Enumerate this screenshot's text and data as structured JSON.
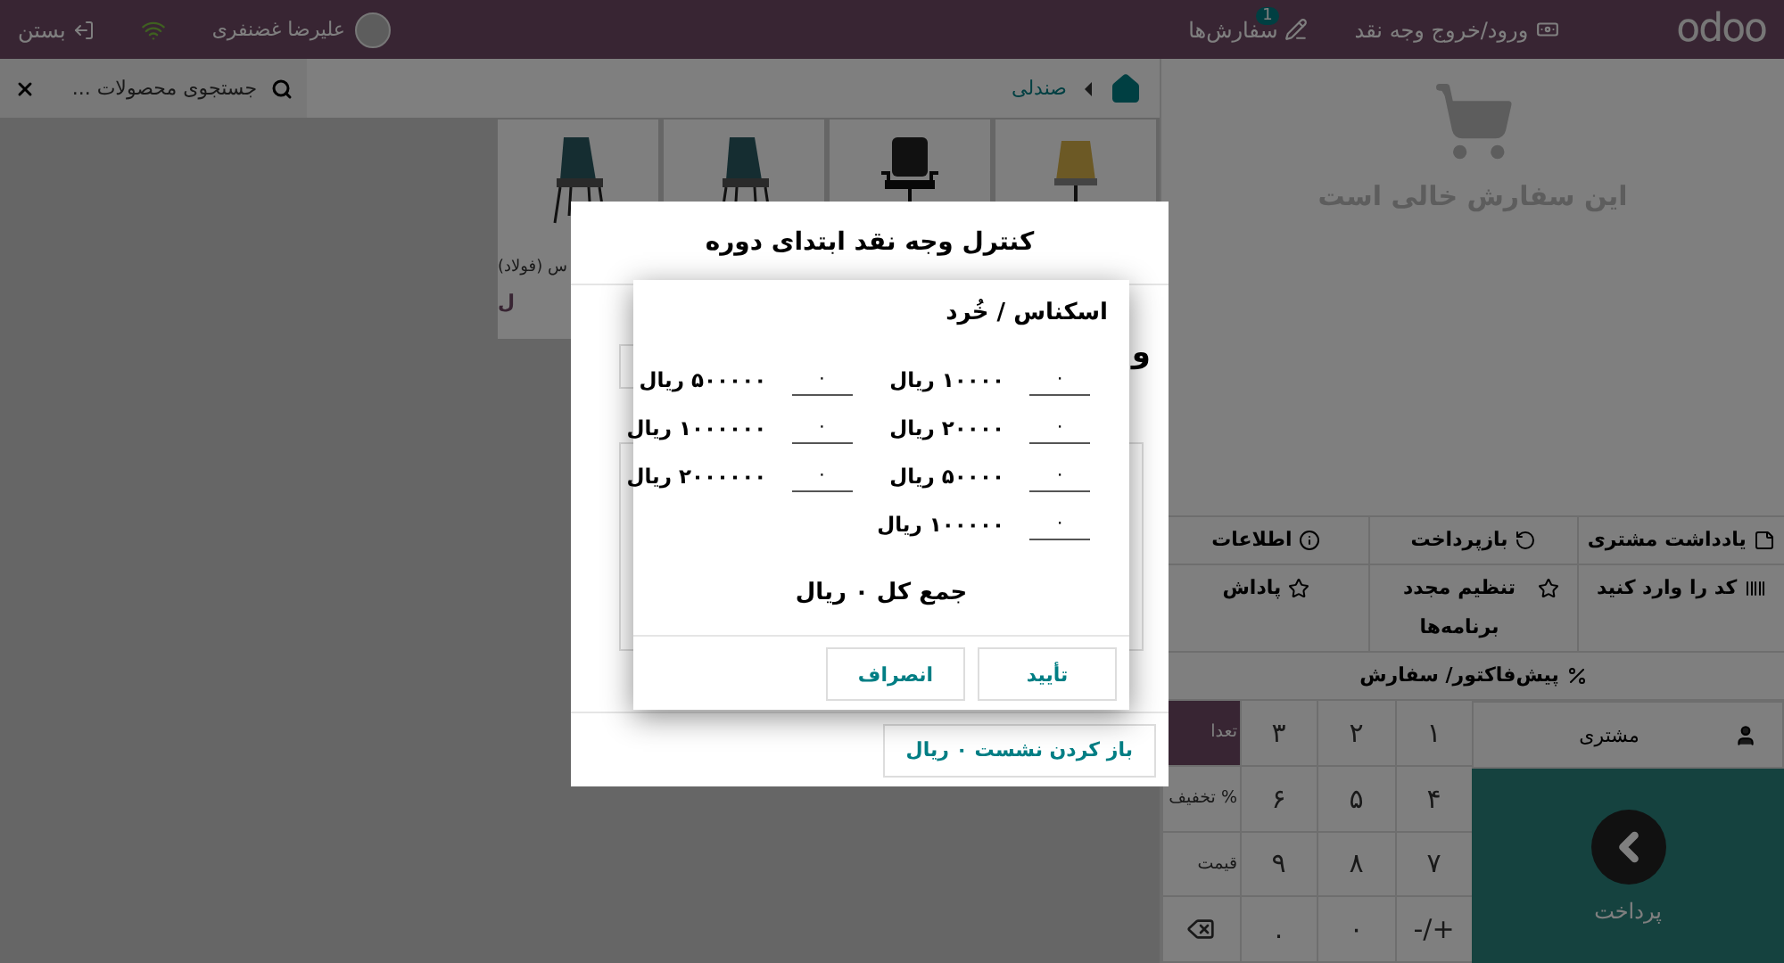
{
  "header": {
    "logo": "odoo",
    "cash_button": "ورود/خروج وجه نقد",
    "orders_button": {
      "label": "سفارش‌ها",
      "badge": "1"
    },
    "user": "علیرضا غضنفری",
    "close_button": "بستن"
  },
  "products": {
    "breadcrumb": "صندلی",
    "search": {
      "placeholder": "جستجوی محصولات ..."
    },
    "items": [
      {
        "kind": "stool"
      },
      {
        "kind": "office"
      },
      {
        "kind": "shell"
      },
      {
        "kind": "shell",
        "name": "س (فولاد)",
        "price": "ل"
      }
    ]
  },
  "order": {
    "empty_text": "این سفارش خالی است",
    "controls": [
      "یادداشت مشتری",
      "بازپرداخت",
      "اطلاعات",
      "کد را وارد کنید",
      "تنظیم مجدد برنامه‌ها",
      "پاداش",
      "پیش‌فاکتور/ سفارش"
    ],
    "customer_button": "مشتری",
    "payment_button": "پرداخت",
    "numpad": [
      {
        "kind": "digit",
        "label": "۱"
      },
      {
        "kind": "digit",
        "label": "۲"
      },
      {
        "kind": "digit",
        "label": "۳"
      },
      {
        "kind": "mode",
        "label": "تعدا",
        "selected": true
      },
      {
        "kind": "digit",
        "label": "۴"
      },
      {
        "kind": "digit",
        "label": "۵"
      },
      {
        "kind": "digit",
        "label": "۶"
      },
      {
        "kind": "mode",
        "label": "% تخفیف",
        "selected": false
      },
      {
        "kind": "digit",
        "label": "۷"
      },
      {
        "kind": "digit",
        "label": "۸"
      },
      {
        "kind": "digit",
        "label": "۹"
      },
      {
        "kind": "mode",
        "label": "قیمت",
        "selected": false
      },
      {
        "kind": "digit",
        "label": "+/-"
      },
      {
        "kind": "digit",
        "label": "۰"
      },
      {
        "kind": "digit",
        "label": "."
      },
      {
        "kind": "backspace"
      }
    ]
  },
  "opening_dialog": {
    "title": "کنترل وجه نقد ابتدای دوره",
    "partial_heading": "و",
    "open_button": "باز کردن نشست ۰ ریال"
  },
  "coins_dialog": {
    "title": "اسکناس / خُرد",
    "bills": [
      {
        "label": "۱۰۰۰۰ ریال",
        "value": "۰"
      },
      {
        "label": "۲۰۰۰۰ ریال",
        "value": "۰"
      },
      {
        "label": "۵۰۰۰۰ ریال",
        "value": "۰"
      },
      {
        "label": "۱۰۰۰۰۰ ریال",
        "value": "۰"
      },
      {
        "label": "۵۰۰۰۰۰ ریال",
        "value": "۰"
      },
      {
        "label": "۱۰۰۰۰۰۰ ریال",
        "value": "۰"
      },
      {
        "label": "۲۰۰۰۰۰۰ ریال",
        "value": "۰"
      }
    ],
    "total": "جمع کل ۰ ریال",
    "confirm_button": "تأیید",
    "cancel_button": "انصراف"
  }
}
